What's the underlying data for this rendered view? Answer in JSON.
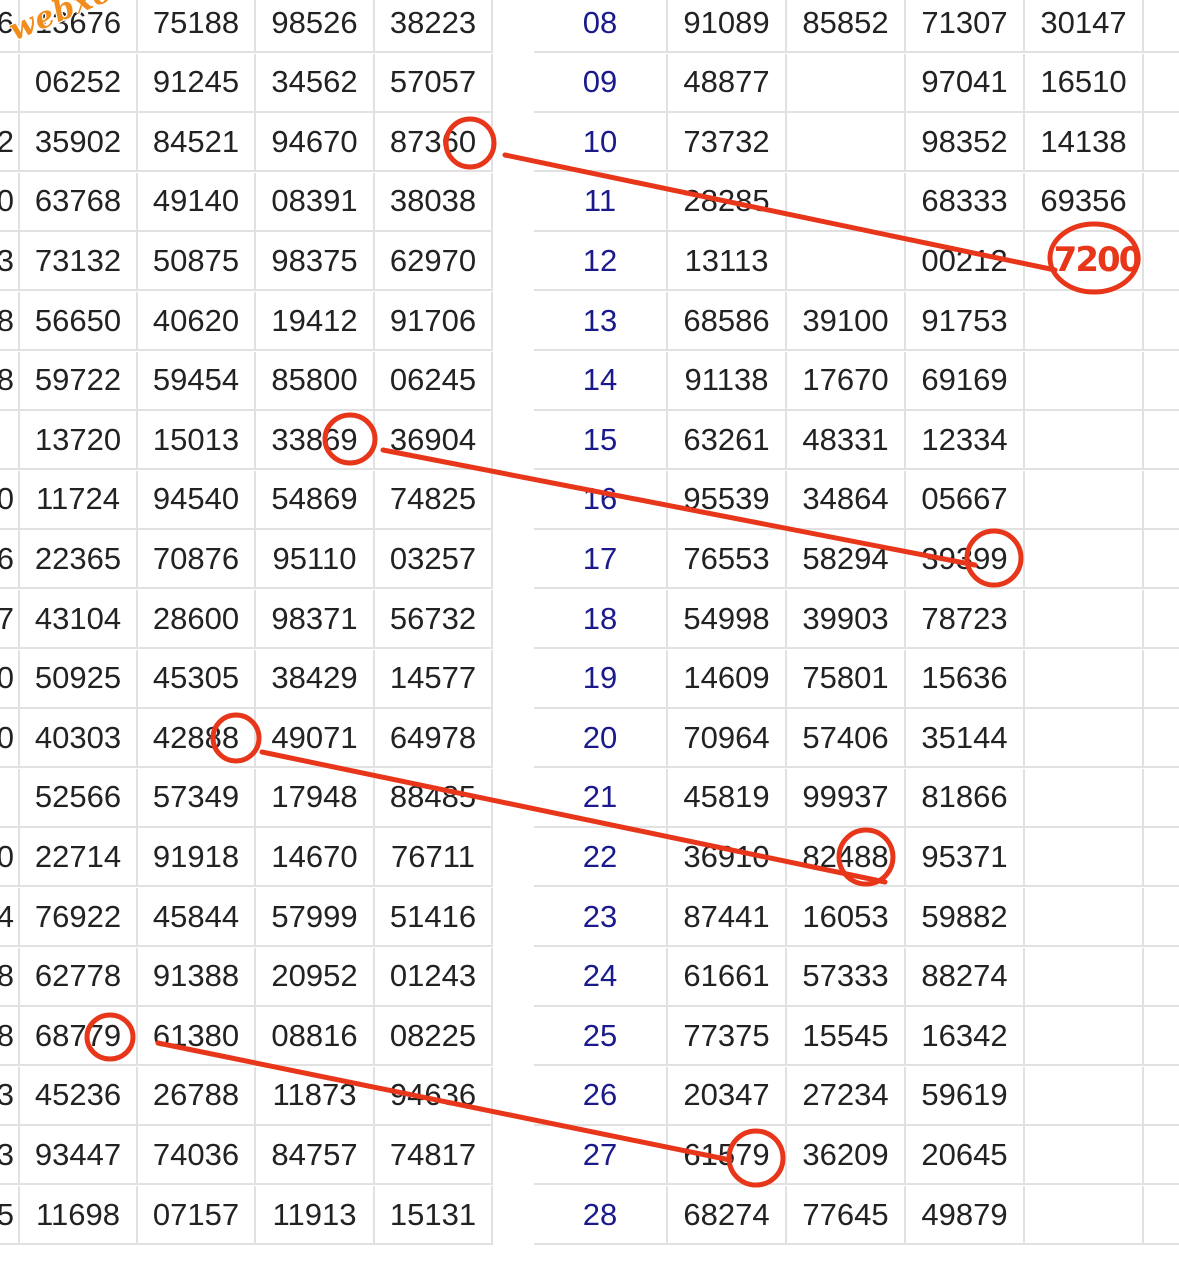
{
  "watermark": "webxoso.net",
  "handwritten_note": "7200",
  "colors": {
    "annotation": "#e8361a",
    "day_number": "#1a1a8c",
    "grid": "#e1e1e1",
    "text": "#222222"
  },
  "left_table": {
    "lead_chars": [
      "6",
      "",
      "2",
      "0",
      "3",
      "8",
      "8",
      "",
      "0",
      "6",
      "7",
      "0",
      "0",
      "",
      "0",
      "4",
      "8",
      "8",
      "3",
      "3",
      "5"
    ],
    "rows": [
      [
        "13676",
        "75188",
        "98526",
        "38223"
      ],
      [
        "06252",
        "91245",
        "34562",
        "57057"
      ],
      [
        "35902",
        "84521",
        "94670",
        "87360"
      ],
      [
        "63768",
        "49140",
        "08391",
        "38038"
      ],
      [
        "73132",
        "50875",
        "98375",
        "62970"
      ],
      [
        "56650",
        "40620",
        "19412",
        "91706"
      ],
      [
        "59722",
        "59454",
        "85800",
        "06245"
      ],
      [
        "13720",
        "15013",
        "33869",
        "36904"
      ],
      [
        "11724",
        "94540",
        "54869",
        "74825"
      ],
      [
        "22365",
        "70876",
        "95110",
        "03257"
      ],
      [
        "43104",
        "28600",
        "98371",
        "56732"
      ],
      [
        "50925",
        "45305",
        "38429",
        "14577"
      ],
      [
        "40303",
        "42888",
        "49071",
        "64978"
      ],
      [
        "52566",
        "57349",
        "17948",
        "88485"
      ],
      [
        "22714",
        "91918",
        "14670",
        "76711"
      ],
      [
        "76922",
        "45844",
        "57999",
        "51416"
      ],
      [
        "62778",
        "91388",
        "20952",
        "01243"
      ],
      [
        "68779",
        "61380",
        "08816",
        "08225"
      ],
      [
        "45236",
        "26788",
        "11873",
        "94636"
      ],
      [
        "93447",
        "74036",
        "84757",
        "74817"
      ],
      [
        "11698",
        "07157",
        "11913",
        "15131"
      ]
    ]
  },
  "right_table": {
    "rows": [
      {
        "day": "08",
        "values": [
          "91089",
          "85852",
          "71307",
          "30147"
        ]
      },
      {
        "day": "09",
        "values": [
          "48877",
          "",
          "97041",
          "16510"
        ]
      },
      {
        "day": "10",
        "values": [
          "73732",
          "",
          "98352",
          "14138"
        ]
      },
      {
        "day": "11",
        "values": [
          "28285",
          "",
          "68333",
          "69356"
        ]
      },
      {
        "day": "12",
        "values": [
          "13113",
          "",
          "00212",
          ""
        ]
      },
      {
        "day": "13",
        "values": [
          "68586",
          "39100",
          "91753",
          ""
        ]
      },
      {
        "day": "14",
        "values": [
          "91138",
          "17670",
          "69169",
          ""
        ]
      },
      {
        "day": "15",
        "values": [
          "63261",
          "48331",
          "12334",
          ""
        ]
      },
      {
        "day": "16",
        "values": [
          "95539",
          "34864",
          "05667",
          ""
        ]
      },
      {
        "day": "17",
        "values": [
          "76553",
          "58294",
          "39399",
          ""
        ]
      },
      {
        "day": "18",
        "values": [
          "54998",
          "39903",
          "78723",
          ""
        ]
      },
      {
        "day": "19",
        "values": [
          "14609",
          "75801",
          "15636",
          ""
        ]
      },
      {
        "day": "20",
        "values": [
          "70964",
          "57406",
          "35144",
          ""
        ]
      },
      {
        "day": "21",
        "values": [
          "45819",
          "99937",
          "81866",
          ""
        ]
      },
      {
        "day": "22",
        "values": [
          "36910",
          "82488",
          "95371",
          ""
        ]
      },
      {
        "day": "23",
        "values": [
          "87441",
          "16053",
          "59882",
          ""
        ]
      },
      {
        "day": "24",
        "values": [
          "61661",
          "57333",
          "88274",
          ""
        ]
      },
      {
        "day": "25",
        "values": [
          "77375",
          "15545",
          "16342",
          ""
        ]
      },
      {
        "day": "26",
        "values": [
          "20347",
          "27234",
          "59619",
          ""
        ]
      },
      {
        "day": "27",
        "values": [
          "61579",
          "36209",
          "20645",
          ""
        ]
      },
      {
        "day": "28",
        "values": [
          "68274",
          "77645",
          "49879",
          ""
        ]
      }
    ]
  }
}
